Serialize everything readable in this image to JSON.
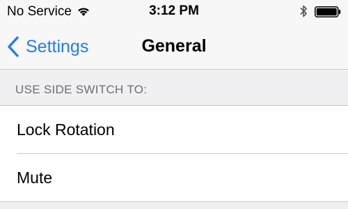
{
  "status_bar": {
    "carrier": "No Service",
    "time": "3:12 PM",
    "icons": [
      "wifi-icon",
      "bluetooth-icon",
      "battery-icon"
    ]
  },
  "nav_bar": {
    "back_label": "Settings",
    "title": "General"
  },
  "section": {
    "header": "USE SIDE SWITCH TO:",
    "items": [
      {
        "label": "Lock Rotation"
      },
      {
        "label": "Mute"
      }
    ]
  },
  "colors": {
    "accent": "#1f7cf6",
    "background": "#efeff4",
    "separator": "#c8c7cc",
    "section_header_text": "#6d6d72"
  }
}
